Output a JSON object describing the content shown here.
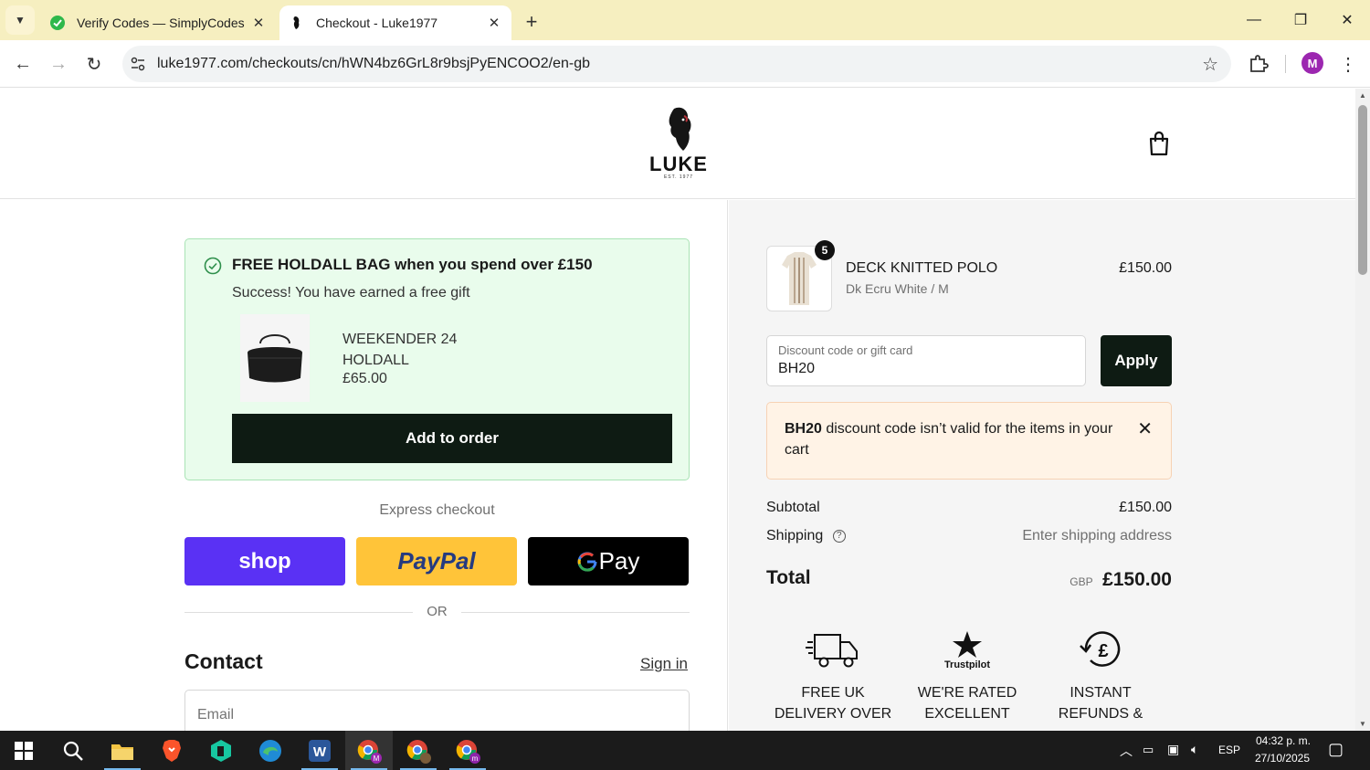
{
  "browser": {
    "tabs": [
      {
        "title": "Verify Codes — SimplyCodes",
        "favicon": "simplycodes-icon",
        "active": false
      },
      {
        "title": "Checkout - Luke1977",
        "favicon": "luke-lion-icon",
        "active": true
      }
    ],
    "url": "luke1977.com/checkouts/cn/hWN4bz6GrL8r9bsjPyENCOO2/en-gb",
    "profile_initial": "M"
  },
  "store": {
    "logo_text": "LUKE",
    "logo_sub": "EST. 1977"
  },
  "gift": {
    "title": "FREE HOLDALL BAG when you spend over £150",
    "subtitle": "Success! You have earned a free gift",
    "item_name": "WEEKENDER 24 HOLDALL",
    "item_price": "£65.00",
    "button_label": "Add to order"
  },
  "express": {
    "label": "Express checkout",
    "shop_label": "shop",
    "paypal_label": "PayPal",
    "gpay_label": "Pay",
    "or_label": "OR"
  },
  "contact": {
    "title": "Contact",
    "sign_in_label": "Sign in",
    "email_placeholder": "Email"
  },
  "order": {
    "product_name": "DECK KNITTED POLO",
    "product_variant": "Dk Ecru White / M",
    "product_price": "£150.00",
    "quantity": "5",
    "discount_label": "Discount code or gift card",
    "discount_value": "BH20",
    "apply_label": "Apply",
    "error_code": "BH20",
    "error_message": " discount code isn’t valid for the items in your cart",
    "subtotal_label": "Subtotal",
    "subtotal_value": "£150.00",
    "shipping_label": "Shipping",
    "shipping_value": "Enter shipping address",
    "total_label": "Total",
    "total_currency": "GBP",
    "total_value": "£150.00"
  },
  "features": [
    {
      "icon": "delivery-truck-icon",
      "text": "FREE UK DELIVERY OVER"
    },
    {
      "icon": "trustpilot-icon",
      "label": "Trustpilot",
      "text": "WE'RE RATED EXCELLENT"
    },
    {
      "icon": "pound-refund-icon",
      "text": "INSTANT REFUNDS &"
    }
  ],
  "system": {
    "language": "ESP",
    "time": "04:32 p. m.",
    "date": "27/10/2025"
  },
  "colors": {
    "accent_dark": "#0e1b13",
    "gift_bg": "#e9fcec",
    "error_bg": "#fff3e6",
    "shop_pay": "#5a31f4",
    "paypal": "#ffc439",
    "chrome_tabbar": "#f6efc0"
  }
}
